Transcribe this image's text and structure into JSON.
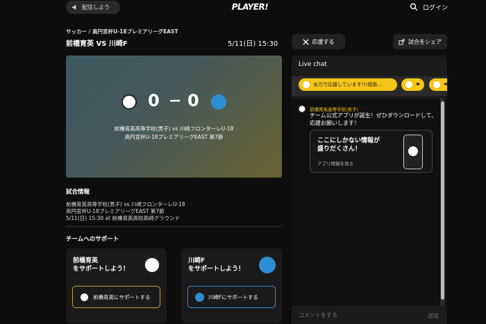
{
  "topbar": {
    "promo_label": "配信しよう",
    "logo_text": "PLAYER!",
    "login_label": "ログイン"
  },
  "match": {
    "breadcrumb": "サッカー / 高円宮杯U-18プレミアリーグEAST",
    "title": "前橋育英 VS 川崎F",
    "date": "5/11(日) 15:30",
    "score_home": "0",
    "score_sep": "−",
    "score_away": "0",
    "hero_line1": "前橋育英高等学校(男子) vs 川崎フロンターレU-18",
    "hero_line2": "高円宮杯U-18プレミアリーグEAST 第7節"
  },
  "actions": {
    "cheer_label": "応援する",
    "share_label": "試合をシェア"
  },
  "info": {
    "heading": "試合情報",
    "line1": "前橋育英高等学校(男子) vs 川崎フロンターレU-18",
    "line2": "高円宮杯U-18プレミアリーグEAST 第7節",
    "line3": "5/11(日) 15:30 at 前橋育英高校高崎グラウンド"
  },
  "support": {
    "heading": "チームへのサポート",
    "home": {
      "title_line1": "前橋育英",
      "title_line2": "をサポートしよう！",
      "button_label": "前橋育英にサポートする"
    },
    "away": {
      "title_line1": "川崎F",
      "title_line2": "をサポートしよう！",
      "button_label": "川崎Fにサポートする"
    }
  },
  "chat": {
    "header": "Live chat",
    "pills": [
      "全力で応援しています!!!頑張...",
      "❤",
      "❤"
    ],
    "message_user": "前橋育英高等学校(男子)",
    "message_text": "チーム公式アプリが誕生！ぜひダウンロードして、応援お願いします！",
    "promo_title_line1": "ここにしかない情報が",
    "promo_title_line2": "盛りだくさん！",
    "promo_link": "アプリ情報を見る",
    "comment_placeholder": "コメントをする",
    "send_label": "送信"
  },
  "colors": {
    "accent_yellow": "#f5c518",
    "home_gold": "#c8a43a",
    "away_blue": "#3b8fd4",
    "background": "#0d0d0d"
  }
}
